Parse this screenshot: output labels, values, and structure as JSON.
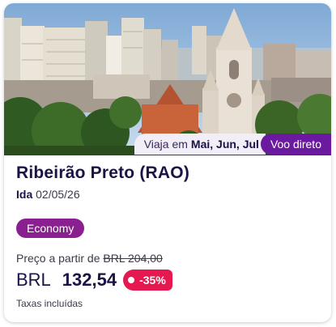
{
  "card": {
    "image_alt": "Ribeirão Preto skyline with cathedral",
    "travel_prefix": "Viaja em",
    "travel_months": "Mai, Jun, Jul",
    "direct_label": "Voo direto",
    "title": "Ribeirão Preto (RAO)",
    "trip_type": "Ida",
    "date": "02/05/26",
    "cabin": "Economy",
    "price_from_label": "Preço a partir de",
    "old_price": "BRL 204,00",
    "currency": "BRL",
    "price": "132,54",
    "discount": "-35%",
    "taxes": "Taxas incluídas"
  },
  "colors": {
    "brand_purple": "#6b1aa0",
    "economy_badge": "#8a1f8f",
    "discount_red": "#e5194f",
    "title_navy": "#1a1446"
  }
}
